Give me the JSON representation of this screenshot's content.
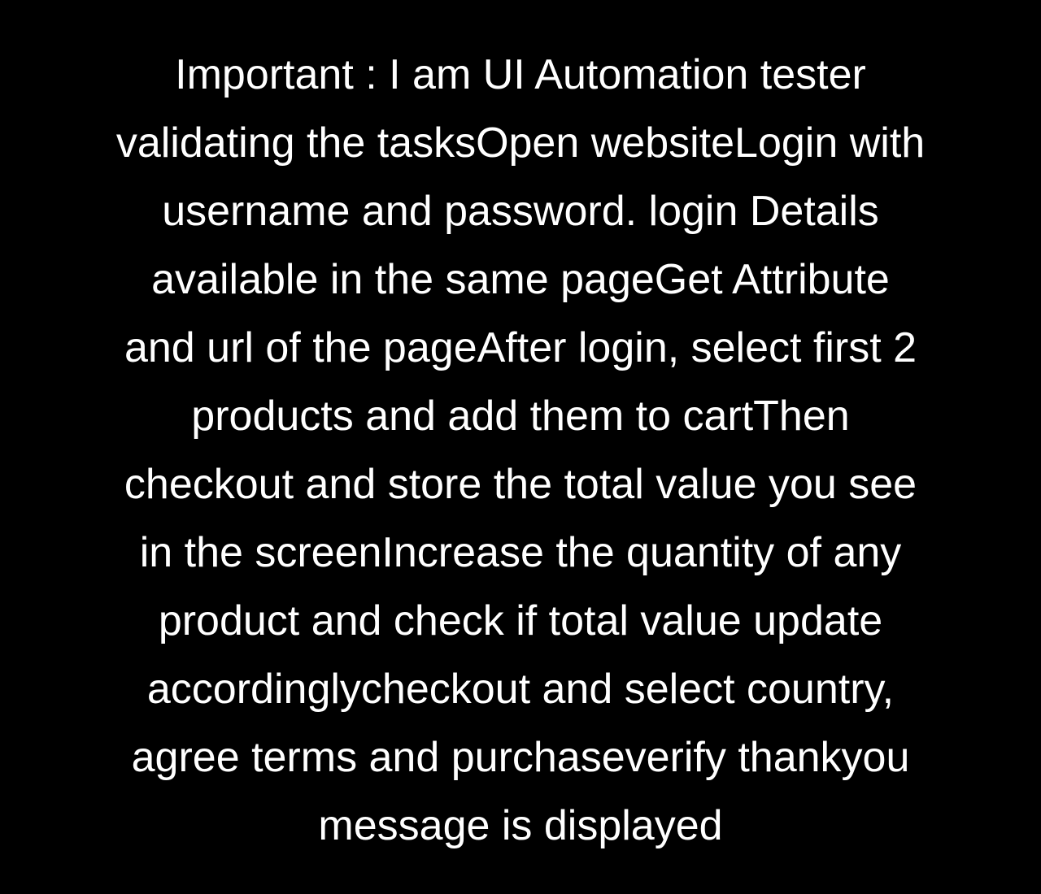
{
  "message": {
    "text": "Important : I am UI Automation tester validating the tasksOpen websiteLogin with username and password. login Details available in the same pageGet Attribute and url of the pageAfter login, select first 2 products and add them to cartThen checkout and store the total value you see in the screenIncrease the quantity of any product and check if total value update accordinglycheckout and select country, agree terms and purchaseverify thankyou message is displayed"
  },
  "colors": {
    "background": "#000000",
    "text": "#ffffff"
  }
}
